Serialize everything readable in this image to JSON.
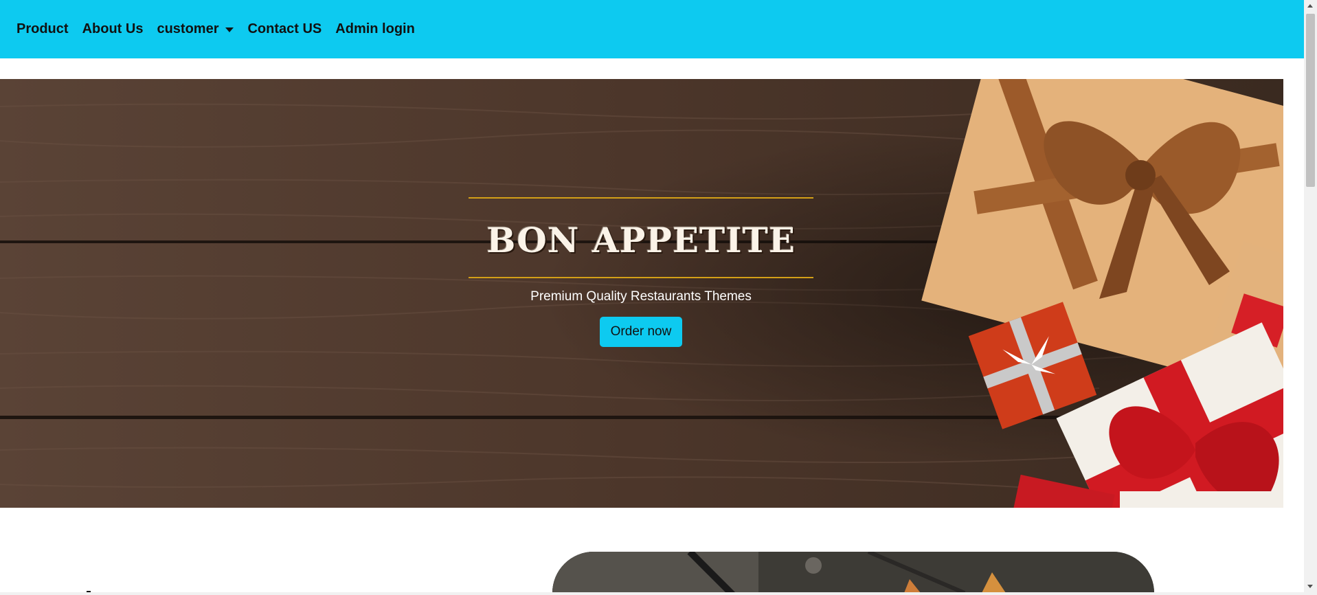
{
  "nav": {
    "items": [
      {
        "label": "Product"
      },
      {
        "label": "About Us"
      },
      {
        "label": "customer"
      },
      {
        "label": "Contact US"
      },
      {
        "label": "Admin login"
      }
    ]
  },
  "hero": {
    "title": "BON APPETITE",
    "subtitle": "Premium Quality Restaurants Themes",
    "cta_label": "Order now"
  },
  "colors": {
    "navbar": "#0dcaf0",
    "accent_line": "#d4a017",
    "button": "#0dcaf0"
  }
}
